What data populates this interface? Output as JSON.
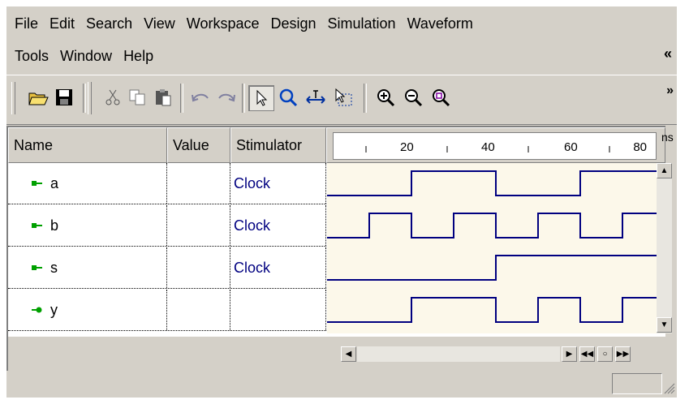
{
  "menu": {
    "row1": [
      "File",
      "Edit",
      "Search",
      "View",
      "Workspace",
      "Design",
      "Simulation",
      "Waveform"
    ],
    "row2": [
      "Tools",
      "Window",
      "Help"
    ],
    "collapse_icon": "chevrons-left-icon"
  },
  "toolbar": {
    "buttons": [
      "open-folder-icon",
      "save-icon",
      "cut-icon",
      "copy-icon",
      "paste-icon",
      "undo-icon",
      "redo-icon",
      "select-pointer-icon",
      "zoom-magnifier-icon",
      "measure-icon",
      "select-region-icon",
      "zoom-in-icon",
      "zoom-out-icon",
      "zoom-fit-icon"
    ],
    "more_icon": "chevrons-right-icon"
  },
  "columns": {
    "name": "Name",
    "value": "Value",
    "stimulator": "Stimulator"
  },
  "ruler": {
    "ticks": [
      "20",
      "40",
      "60",
      "80"
    ],
    "unit": "ns"
  },
  "signals": [
    {
      "name": "a",
      "value": "",
      "stimulator": "Clock",
      "direction": "input"
    },
    {
      "name": "b",
      "value": "",
      "stimulator": "Clock",
      "direction": "input"
    },
    {
      "name": "s",
      "value": "",
      "stimulator": "Clock",
      "direction": "input"
    },
    {
      "name": "y",
      "value": "",
      "stimulator": "",
      "direction": "output"
    }
  ],
  "waveforms": {
    "time_range_ns": [
      0,
      80
    ],
    "a": [
      [
        0,
        0
      ],
      [
        20,
        1
      ],
      [
        40,
        0
      ],
      [
        60,
        1
      ]
    ],
    "b": [
      [
        0,
        0
      ],
      [
        10,
        1
      ],
      [
        20,
        0
      ],
      [
        30,
        1
      ],
      [
        40,
        0
      ],
      [
        50,
        1
      ],
      [
        60,
        0
      ],
      [
        70,
        1
      ]
    ],
    "s": [
      [
        0,
        0
      ],
      [
        40,
        1
      ]
    ],
    "y": [
      [
        0,
        0
      ],
      [
        20,
        1
      ],
      [
        40,
        0
      ],
      [
        50,
        1
      ],
      [
        60,
        0
      ],
      [
        70,
        1
      ]
    ]
  },
  "colors": {
    "wave": "#000080",
    "wave_bg": "#fcf8ea",
    "chrome": "#d4d0c8",
    "stimulator_text": "#000080",
    "signal_icon": "#00a000"
  }
}
